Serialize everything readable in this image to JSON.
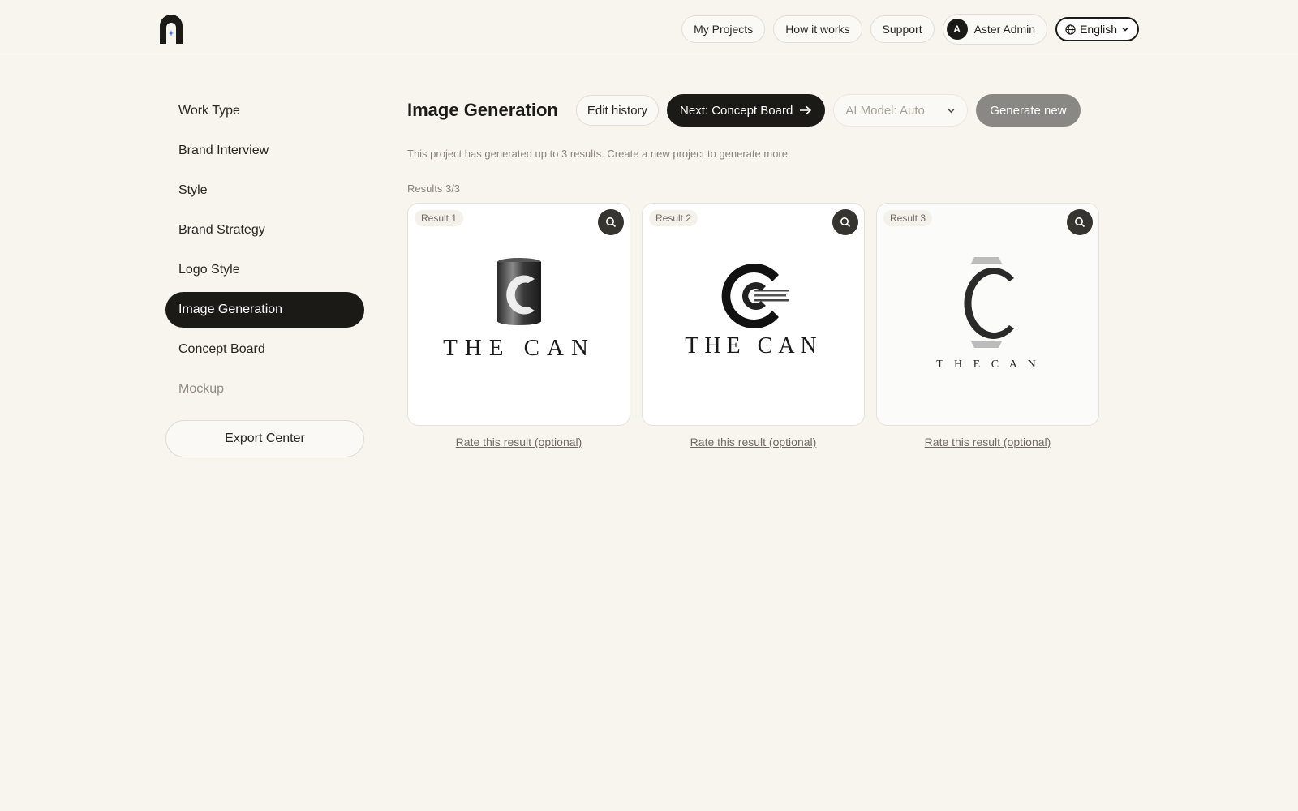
{
  "header": {
    "logo_icon": "arch-sparkle-logo",
    "nav": [
      "My Projects",
      "How it works",
      "Support"
    ],
    "user": {
      "initial": "A",
      "name": "Aster Admin"
    },
    "language": "English"
  },
  "sidebar": {
    "items": [
      {
        "label": "Work Type",
        "state": "normal"
      },
      {
        "label": "Brand Interview",
        "state": "normal"
      },
      {
        "label": "Style",
        "state": "normal"
      },
      {
        "label": "Brand Strategy",
        "state": "normal"
      },
      {
        "label": "Logo Style",
        "state": "normal"
      },
      {
        "label": "Image Generation",
        "state": "active"
      },
      {
        "label": "Concept Board",
        "state": "normal"
      },
      {
        "label": "Mockup",
        "state": "muted"
      }
    ],
    "export_label": "Export Center"
  },
  "main": {
    "title": "Image Generation",
    "edit_history": "Edit history",
    "next_label": "Next: Concept Board",
    "model_select": "AI Model: Auto",
    "generate_label": "Generate new",
    "notice": "This project has generated up to 3 results. Create a new project to generate more.",
    "results_label": "Results 3/3",
    "results": [
      {
        "badge": "Result 1",
        "wordmark": "THE CAN",
        "rate": "Rate this result (optional)"
      },
      {
        "badge": "Result 2",
        "wordmark": "THE CAN",
        "rate": "Rate this result (optional)"
      },
      {
        "badge": "Result 3",
        "wordmark": "T H E   C A N",
        "rate": "Rate this result (optional)"
      }
    ]
  },
  "colors": {
    "background": "#f8f5ef",
    "dark": "#1c1a17",
    "generate_button": "#8a8884"
  }
}
